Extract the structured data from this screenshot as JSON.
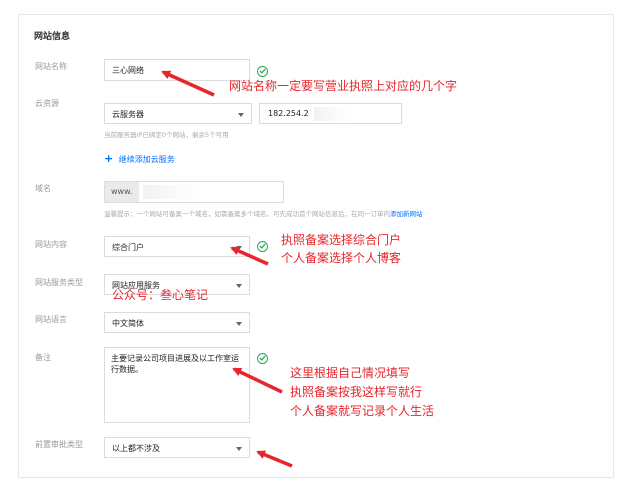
{
  "section_title": "网站信息",
  "fields": {
    "site_name": {
      "label": "网站名称",
      "value": "三心网络"
    },
    "cloud_resource": {
      "label": "云资源",
      "select_value": "云服务器",
      "ip_value": "182.254.2",
      "hint": "当前服务器IP已绑定0个网站，剩余5个可用",
      "add_link": "继续添加云服务"
    },
    "domain": {
      "label": "域名",
      "value": "www.",
      "hint": "温馨提示：一个网站可备案一个域名，如需备案多个域名，可先成功首个网站信息后，在同一订单内",
      "add_site_link": "添加新网站"
    },
    "content_type": {
      "label": "网站内容",
      "value": "综合门户"
    },
    "service_type": {
      "label": "网站服务类型",
      "value": "网站应用服务"
    },
    "language": {
      "label": "网站语言",
      "value": "中文简体"
    },
    "remark": {
      "label": "备注",
      "value": "主要记录公司项目进展及以工作室运行数据。"
    },
    "approval_type": {
      "label": "前置审批类型",
      "value": "以上都不涉及"
    }
  },
  "annotations": {
    "site_name_note": "网站名称一定要写营业执照上对应的几个字",
    "content_note_1": "执照备案选择综合门户",
    "content_note_2": "个人备案选择个人博客",
    "watermark": "公众号：叁心笔记",
    "remark_note_1": "这里根据自己情况填写",
    "remark_note_2": "执照备案按我这样写就行",
    "remark_note_3": "个人备案就写记录个人生活"
  },
  "colors": {
    "annotation_red": "#e8252b",
    "success_green": "#29a85a",
    "link_blue": "#006eff"
  },
  "icons": [
    "check-circle-icon",
    "plus-icon",
    "chevron-down-icon",
    "red-arrow"
  ]
}
